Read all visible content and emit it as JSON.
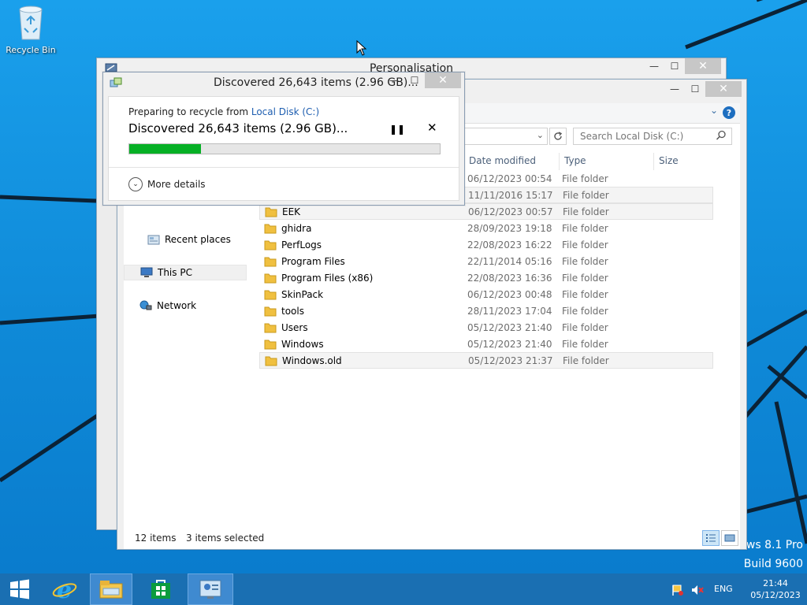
{
  "desktop": {
    "recycle_bin_label": "Recycle Bin",
    "watermark_line1": "ows 8.1 Pro",
    "watermark_line2": "Build 9600"
  },
  "personalisation_window": {
    "title": "Personalisation"
  },
  "explorer": {
    "search_placeholder": "Search Local Disk (C:)",
    "columns": {
      "date_modified": "Date modified",
      "type": "Type",
      "size": "Size"
    },
    "nav": {
      "recent_places": "Recent places",
      "this_pc": "This PC",
      "network": "Network"
    },
    "rows": [
      {
        "name": "",
        "date": "06/12/2023 00:54",
        "type": "File folder"
      },
      {
        "name": "",
        "date": "11/11/2016 15:17",
        "type": "File folder"
      },
      {
        "name": "EEK",
        "date": "06/12/2023 00:57",
        "type": "File folder"
      },
      {
        "name": "ghidra",
        "date": "28/09/2023 19:18",
        "type": "File folder"
      },
      {
        "name": "PerfLogs",
        "date": "22/08/2023 16:22",
        "type": "File folder"
      },
      {
        "name": "Program Files",
        "date": "22/11/2014 05:16",
        "type": "File folder"
      },
      {
        "name": "Program Files (x86)",
        "date": "22/08/2023 16:36",
        "type": "File folder"
      },
      {
        "name": "SkinPack",
        "date": "06/12/2023 00:48",
        "type": "File folder"
      },
      {
        "name": "tools",
        "date": "28/11/2023 17:04",
        "type": "File folder"
      },
      {
        "name": "Users",
        "date": "05/12/2023 21:40",
        "type": "File folder"
      },
      {
        "name": "Windows",
        "date": "05/12/2023 21:40",
        "type": "File folder"
      },
      {
        "name": "Windows.old",
        "date": "05/12/2023 21:37",
        "type": "File folder"
      }
    ],
    "status": {
      "item_count": "12 items",
      "selected": "3 items selected"
    }
  },
  "progress_dialog": {
    "title": "Discovered 26,643 items (2.96 GB)...",
    "preparing_text": "Preparing to recycle from ",
    "source_link": "Local Disk (C:)",
    "discovered_text": "Discovered 26,643 items (2.96 GB)...",
    "progress": 0.23,
    "progress_color": "#06b025",
    "more_details": "More details"
  },
  "taskbar": {
    "language": "ENG",
    "time": "21:44",
    "date": "05/12/2023"
  }
}
